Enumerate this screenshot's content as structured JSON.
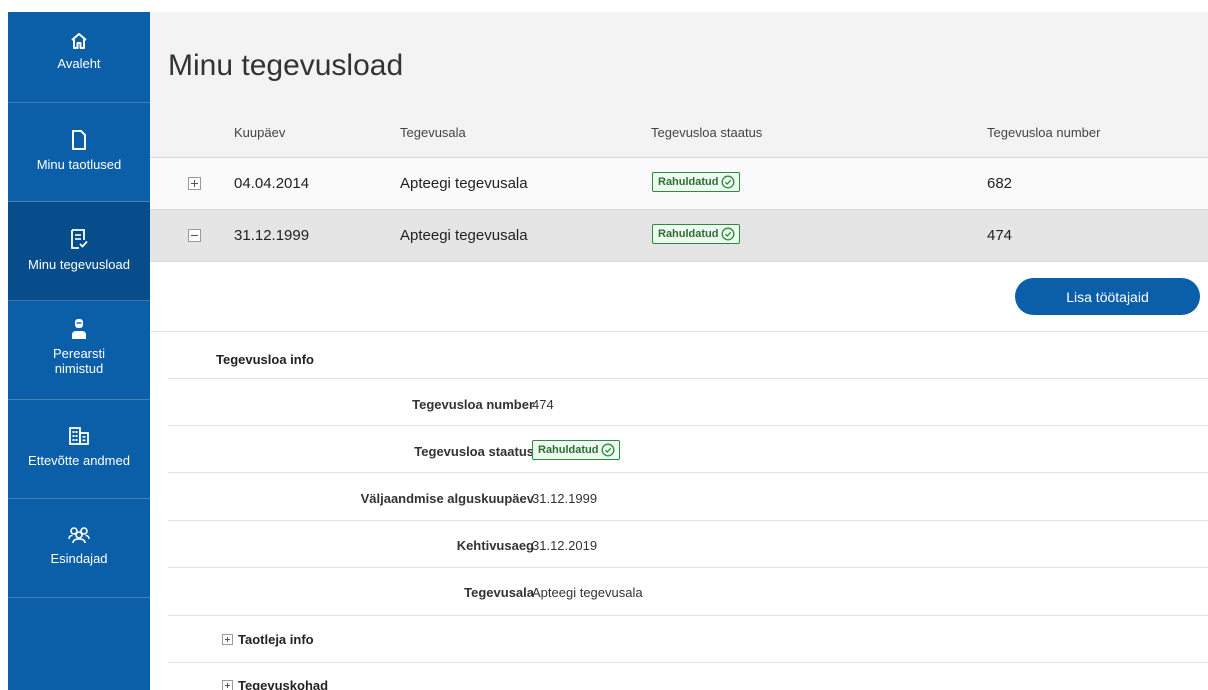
{
  "sidebar": {
    "items": [
      {
        "label": "Avaleht",
        "icon": "home-icon"
      },
      {
        "label": "Minu taotlused",
        "icon": "document-icon"
      },
      {
        "label": "Minu tegevusload",
        "icon": "license-icon",
        "active": true
      },
      {
        "label_line1": "Perearsti",
        "label_line2": "nimistud",
        "icon": "doctor-icon"
      },
      {
        "label": "Ettevõtte andmed",
        "icon": "building-icon"
      },
      {
        "label": "Esindajad",
        "icon": "people-icon"
      }
    ]
  },
  "page": {
    "title": "Minu tegevusload"
  },
  "table": {
    "headers": {
      "date": "Kuupäev",
      "activity": "Tegevusala",
      "status": "Tegevusloa staatus",
      "number": "Tegevusloa number"
    },
    "rows": [
      {
        "date": "04.04.2014",
        "activity": "Apteegi tegevusala",
        "status": "Rahuldatud",
        "number": "682",
        "expanded": false
      },
      {
        "date": "31.12.1999",
        "activity": "Apteegi tegevusala",
        "status": "Rahuldatud",
        "number": "474",
        "expanded": true
      }
    ]
  },
  "actions": {
    "add_workers_label": "Lisa töötajaid"
  },
  "details": {
    "section_title": "Tegevusloa info",
    "fields": {
      "number_label": "Tegevusloa number",
      "number_value": "474",
      "status_label": "Tegevusloa staatus",
      "status_value": "Rahuldatud",
      "issue_date_label": "Väljaandmise alguskuupäev",
      "issue_date_value": "31.12.1999",
      "validity_label": "Kehtivusaeg",
      "validity_value": "31.12.2019",
      "activity_label": "Tegevusala",
      "activity_value": "Apteegi tegevusala"
    },
    "subsections": {
      "applicant": "Taotleja info",
      "locations": "Tegevuskohad"
    }
  },
  "colors": {
    "sidebar": "#0a5fa8",
    "sidebar_active": "#074d8c",
    "status_ok": "#2b8a3e",
    "primary_button": "#0a5fa8"
  }
}
